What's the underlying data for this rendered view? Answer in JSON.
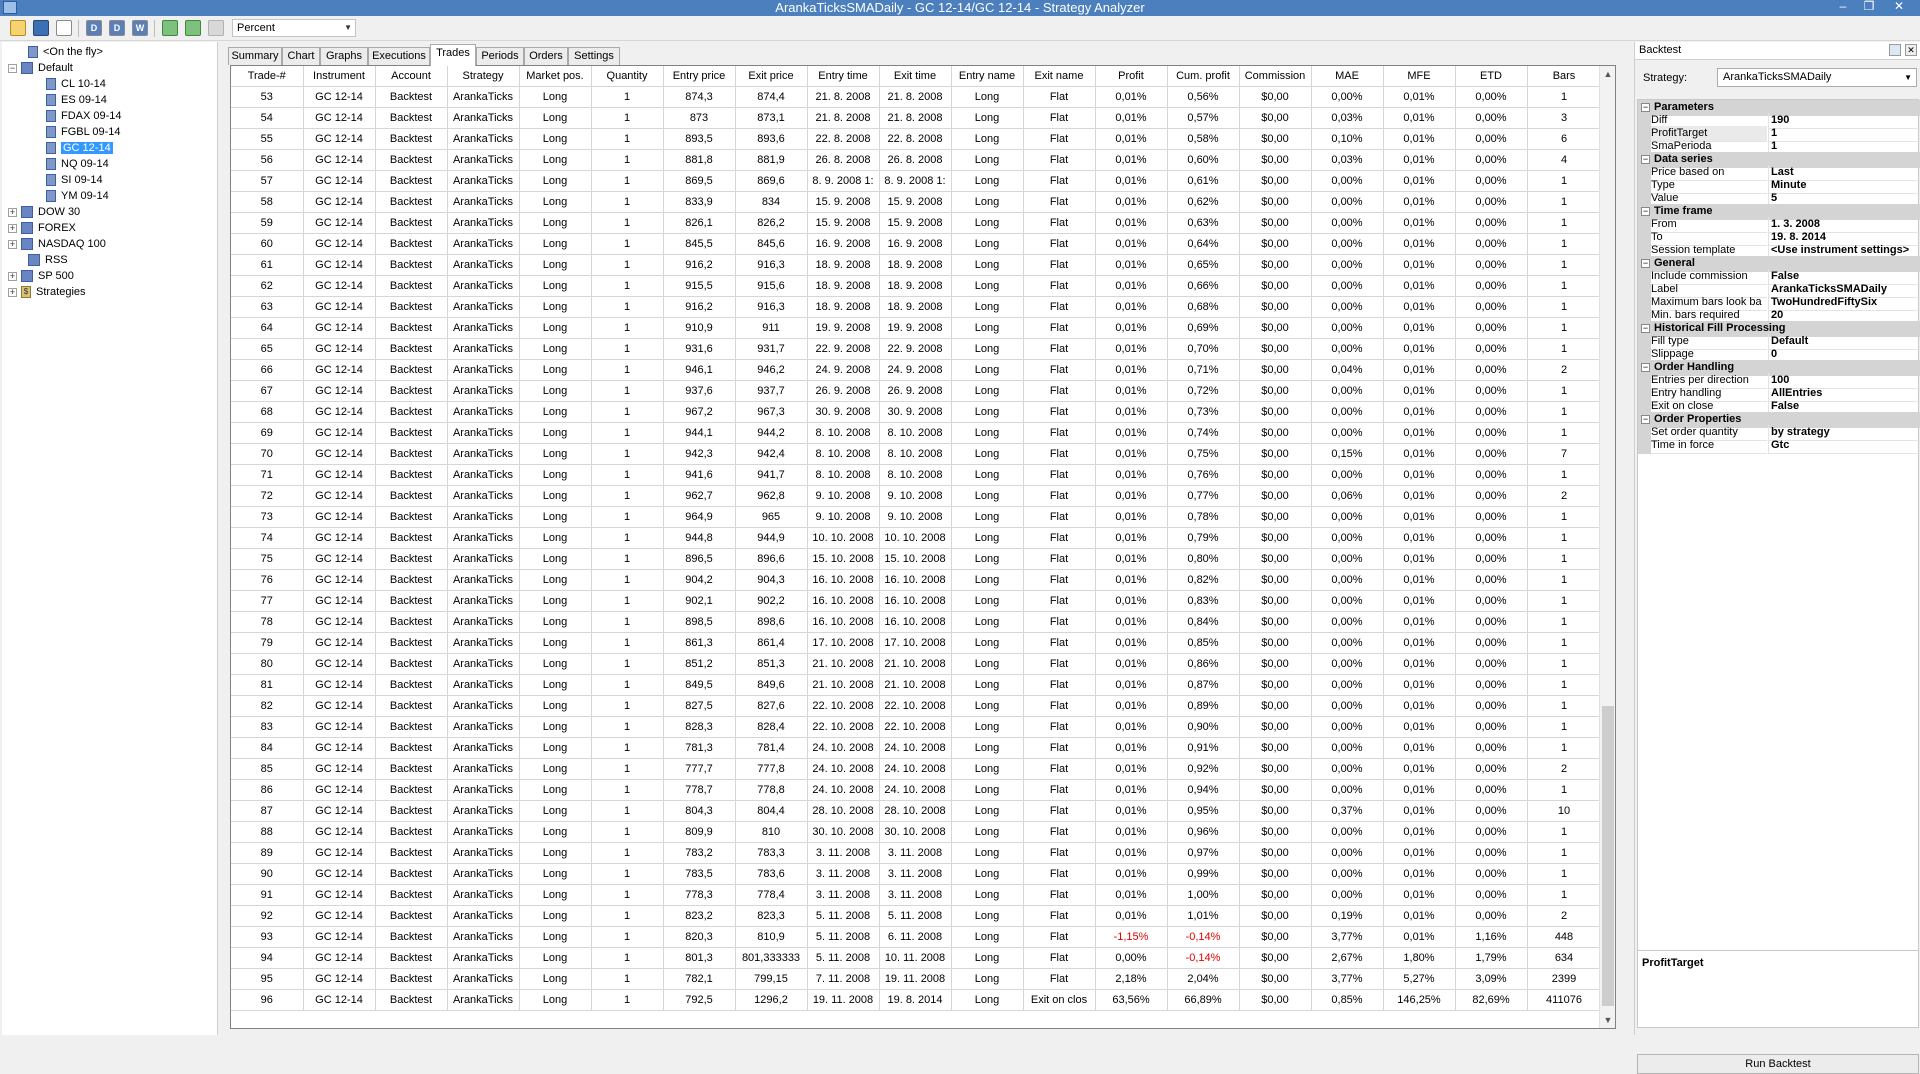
{
  "window": {
    "title": "ArankaTicksSMADaily - GC 12-14/GC 12-14 - Strategy Analyzer"
  },
  "toolbar": {
    "display_combo": "Percent"
  },
  "tree": {
    "nodes": [
      {
        "label": "<On the fly>"
      },
      {
        "label": "Default"
      },
      {
        "label": "CL 10-14"
      },
      {
        "label": "ES 09-14"
      },
      {
        "label": "FDAX 09-14"
      },
      {
        "label": "FGBL 09-14"
      },
      {
        "label": "GC 12-14"
      },
      {
        "label": "NQ 09-14"
      },
      {
        "label": "SI 09-14"
      },
      {
        "label": "YM 09-14"
      },
      {
        "label": "DOW 30"
      },
      {
        "label": "FOREX"
      },
      {
        "label": "NASDAQ 100"
      },
      {
        "label": "RSS"
      },
      {
        "label": "SP 500"
      },
      {
        "label": "Strategies"
      }
    ]
  },
  "tabs": [
    "Summary",
    "Chart",
    "Graphs",
    "Executions",
    "Trades",
    "Periods",
    "Orders",
    "Settings"
  ],
  "grid": {
    "columns": [
      "Trade-#",
      "Instrument",
      "Account",
      "Strategy",
      "Market pos.",
      "Quantity",
      "Entry price",
      "Exit price",
      "Entry time",
      "Exit time",
      "Entry name",
      "Exit name",
      "Profit",
      "Cum. profit",
      "Commission",
      "MAE",
      "MFE",
      "ETD",
      "Bars"
    ],
    "rows": [
      [
        "53",
        "GC 12-14",
        "Backtest",
        "ArankaTicks",
        "Long",
        "1",
        "874,3",
        "874,4",
        "21. 8. 2008",
        "21. 8. 2008",
        "Long",
        "Flat",
        "0,01%",
        "0,56%",
        "$0,00",
        "0,00%",
        "0,01%",
        "0,00%",
        "1"
      ],
      [
        "54",
        "GC 12-14",
        "Backtest",
        "ArankaTicks",
        "Long",
        "1",
        "873",
        "873,1",
        "21. 8. 2008",
        "21. 8. 2008",
        "Long",
        "Flat",
        "0,01%",
        "0,57%",
        "$0,00",
        "0,03%",
        "0,01%",
        "0,00%",
        "3"
      ],
      [
        "55",
        "GC 12-14",
        "Backtest",
        "ArankaTicks",
        "Long",
        "1",
        "893,5",
        "893,6",
        "22. 8. 2008",
        "22. 8. 2008",
        "Long",
        "Flat",
        "0,01%",
        "0,58%",
        "$0,00",
        "0,10%",
        "0,01%",
        "0,00%",
        "6"
      ],
      [
        "56",
        "GC 12-14",
        "Backtest",
        "ArankaTicks",
        "Long",
        "1",
        "881,8",
        "881,9",
        "26. 8. 2008",
        "26. 8. 2008",
        "Long",
        "Flat",
        "0,01%",
        "0,60%",
        "$0,00",
        "0,03%",
        "0,01%",
        "0,00%",
        "4"
      ],
      [
        "57",
        "GC 12-14",
        "Backtest",
        "ArankaTicks",
        "Long",
        "1",
        "869,5",
        "869,6",
        "8. 9. 2008 1:",
        "8. 9. 2008 1:",
        "Long",
        "Flat",
        "0,01%",
        "0,61%",
        "$0,00",
        "0,00%",
        "0,01%",
        "0,00%",
        "1"
      ],
      [
        "58",
        "GC 12-14",
        "Backtest",
        "ArankaTicks",
        "Long",
        "1",
        "833,9",
        "834",
        "15. 9. 2008",
        "15. 9. 2008",
        "Long",
        "Flat",
        "0,01%",
        "0,62%",
        "$0,00",
        "0,00%",
        "0,01%",
        "0,00%",
        "1"
      ],
      [
        "59",
        "GC 12-14",
        "Backtest",
        "ArankaTicks",
        "Long",
        "1",
        "826,1",
        "826,2",
        "15. 9. 2008",
        "15. 9. 2008",
        "Long",
        "Flat",
        "0,01%",
        "0,63%",
        "$0,00",
        "0,00%",
        "0,01%",
        "0,00%",
        "1"
      ],
      [
        "60",
        "GC 12-14",
        "Backtest",
        "ArankaTicks",
        "Long",
        "1",
        "845,5",
        "845,6",
        "16. 9. 2008",
        "16. 9. 2008",
        "Long",
        "Flat",
        "0,01%",
        "0,64%",
        "$0,00",
        "0,00%",
        "0,01%",
        "0,00%",
        "1"
      ],
      [
        "61",
        "GC 12-14",
        "Backtest",
        "ArankaTicks",
        "Long",
        "1",
        "916,2",
        "916,3",
        "18. 9. 2008",
        "18. 9. 2008",
        "Long",
        "Flat",
        "0,01%",
        "0,65%",
        "$0,00",
        "0,00%",
        "0,01%",
        "0,00%",
        "1"
      ],
      [
        "62",
        "GC 12-14",
        "Backtest",
        "ArankaTicks",
        "Long",
        "1",
        "915,5",
        "915,6",
        "18. 9. 2008",
        "18. 9. 2008",
        "Long",
        "Flat",
        "0,01%",
        "0,66%",
        "$0,00",
        "0,00%",
        "0,01%",
        "0,00%",
        "1"
      ],
      [
        "63",
        "GC 12-14",
        "Backtest",
        "ArankaTicks",
        "Long",
        "1",
        "916,2",
        "916,3",
        "18. 9. 2008",
        "18. 9. 2008",
        "Long",
        "Flat",
        "0,01%",
        "0,68%",
        "$0,00",
        "0,00%",
        "0,01%",
        "0,00%",
        "1"
      ],
      [
        "64",
        "GC 12-14",
        "Backtest",
        "ArankaTicks",
        "Long",
        "1",
        "910,9",
        "911",
        "19. 9. 2008",
        "19. 9. 2008",
        "Long",
        "Flat",
        "0,01%",
        "0,69%",
        "$0,00",
        "0,00%",
        "0,01%",
        "0,00%",
        "1"
      ],
      [
        "65",
        "GC 12-14",
        "Backtest",
        "ArankaTicks",
        "Long",
        "1",
        "931,6",
        "931,7",
        "22. 9. 2008",
        "22. 9. 2008",
        "Long",
        "Flat",
        "0,01%",
        "0,70%",
        "$0,00",
        "0,00%",
        "0,01%",
        "0,00%",
        "1"
      ],
      [
        "66",
        "GC 12-14",
        "Backtest",
        "ArankaTicks",
        "Long",
        "1",
        "946,1",
        "946,2",
        "24. 9. 2008",
        "24. 9. 2008",
        "Long",
        "Flat",
        "0,01%",
        "0,71%",
        "$0,00",
        "0,04%",
        "0,01%",
        "0,00%",
        "2"
      ],
      [
        "67",
        "GC 12-14",
        "Backtest",
        "ArankaTicks",
        "Long",
        "1",
        "937,6",
        "937,7",
        "26. 9. 2008",
        "26. 9. 2008",
        "Long",
        "Flat",
        "0,01%",
        "0,72%",
        "$0,00",
        "0,00%",
        "0,01%",
        "0,00%",
        "1"
      ],
      [
        "68",
        "GC 12-14",
        "Backtest",
        "ArankaTicks",
        "Long",
        "1",
        "967,2",
        "967,3",
        "30. 9. 2008",
        "30. 9. 2008",
        "Long",
        "Flat",
        "0,01%",
        "0,73%",
        "$0,00",
        "0,00%",
        "0,01%",
        "0,00%",
        "1"
      ],
      [
        "69",
        "GC 12-14",
        "Backtest",
        "ArankaTicks",
        "Long",
        "1",
        "944,1",
        "944,2",
        "8. 10. 2008",
        "8. 10. 2008",
        "Long",
        "Flat",
        "0,01%",
        "0,74%",
        "$0,00",
        "0,00%",
        "0,01%",
        "0,00%",
        "1"
      ],
      [
        "70",
        "GC 12-14",
        "Backtest",
        "ArankaTicks",
        "Long",
        "1",
        "942,3",
        "942,4",
        "8. 10. 2008",
        "8. 10. 2008",
        "Long",
        "Flat",
        "0,01%",
        "0,75%",
        "$0,00",
        "0,15%",
        "0,01%",
        "0,00%",
        "7"
      ],
      [
        "71",
        "GC 12-14",
        "Backtest",
        "ArankaTicks",
        "Long",
        "1",
        "941,6",
        "941,7",
        "8. 10. 2008",
        "8. 10. 2008",
        "Long",
        "Flat",
        "0,01%",
        "0,76%",
        "$0,00",
        "0,00%",
        "0,01%",
        "0,00%",
        "1"
      ],
      [
        "72",
        "GC 12-14",
        "Backtest",
        "ArankaTicks",
        "Long",
        "1",
        "962,7",
        "962,8",
        "9. 10. 2008",
        "9. 10. 2008",
        "Long",
        "Flat",
        "0,01%",
        "0,77%",
        "$0,00",
        "0,06%",
        "0,01%",
        "0,00%",
        "2"
      ],
      [
        "73",
        "GC 12-14",
        "Backtest",
        "ArankaTicks",
        "Long",
        "1",
        "964,9",
        "965",
        "9. 10. 2008",
        "9. 10. 2008",
        "Long",
        "Flat",
        "0,01%",
        "0,78%",
        "$0,00",
        "0,00%",
        "0,01%",
        "0,00%",
        "1"
      ],
      [
        "74",
        "GC 12-14",
        "Backtest",
        "ArankaTicks",
        "Long",
        "1",
        "944,8",
        "944,9",
        "10. 10. 2008",
        "10. 10. 2008",
        "Long",
        "Flat",
        "0,01%",
        "0,79%",
        "$0,00",
        "0,00%",
        "0,01%",
        "0,00%",
        "1"
      ],
      [
        "75",
        "GC 12-14",
        "Backtest",
        "ArankaTicks",
        "Long",
        "1",
        "896,5",
        "896,6",
        "15. 10. 2008",
        "15. 10. 2008",
        "Long",
        "Flat",
        "0,01%",
        "0,80%",
        "$0,00",
        "0,00%",
        "0,01%",
        "0,00%",
        "1"
      ],
      [
        "76",
        "GC 12-14",
        "Backtest",
        "ArankaTicks",
        "Long",
        "1",
        "904,2",
        "904,3",
        "16. 10. 2008",
        "16. 10. 2008",
        "Long",
        "Flat",
        "0,01%",
        "0,82%",
        "$0,00",
        "0,00%",
        "0,01%",
        "0,00%",
        "1"
      ],
      [
        "77",
        "GC 12-14",
        "Backtest",
        "ArankaTicks",
        "Long",
        "1",
        "902,1",
        "902,2",
        "16. 10. 2008",
        "16. 10. 2008",
        "Long",
        "Flat",
        "0,01%",
        "0,83%",
        "$0,00",
        "0,00%",
        "0,01%",
        "0,00%",
        "1"
      ],
      [
        "78",
        "GC 12-14",
        "Backtest",
        "ArankaTicks",
        "Long",
        "1",
        "898,5",
        "898,6",
        "16. 10. 2008",
        "16. 10. 2008",
        "Long",
        "Flat",
        "0,01%",
        "0,84%",
        "$0,00",
        "0,00%",
        "0,01%",
        "0,00%",
        "1"
      ],
      [
        "79",
        "GC 12-14",
        "Backtest",
        "ArankaTicks",
        "Long",
        "1",
        "861,3",
        "861,4",
        "17. 10. 2008",
        "17. 10. 2008",
        "Long",
        "Flat",
        "0,01%",
        "0,85%",
        "$0,00",
        "0,00%",
        "0,01%",
        "0,00%",
        "1"
      ],
      [
        "80",
        "GC 12-14",
        "Backtest",
        "ArankaTicks",
        "Long",
        "1",
        "851,2",
        "851,3",
        "21. 10. 2008",
        "21. 10. 2008",
        "Long",
        "Flat",
        "0,01%",
        "0,86%",
        "$0,00",
        "0,00%",
        "0,01%",
        "0,00%",
        "1"
      ],
      [
        "81",
        "GC 12-14",
        "Backtest",
        "ArankaTicks",
        "Long",
        "1",
        "849,5",
        "849,6",
        "21. 10. 2008",
        "21. 10. 2008",
        "Long",
        "Flat",
        "0,01%",
        "0,87%",
        "$0,00",
        "0,00%",
        "0,01%",
        "0,00%",
        "1"
      ],
      [
        "82",
        "GC 12-14",
        "Backtest",
        "ArankaTicks",
        "Long",
        "1",
        "827,5",
        "827,6",
        "22. 10. 2008",
        "22. 10. 2008",
        "Long",
        "Flat",
        "0,01%",
        "0,89%",
        "$0,00",
        "0,00%",
        "0,01%",
        "0,00%",
        "1"
      ],
      [
        "83",
        "GC 12-14",
        "Backtest",
        "ArankaTicks",
        "Long",
        "1",
        "828,3",
        "828,4",
        "22. 10. 2008",
        "22. 10. 2008",
        "Long",
        "Flat",
        "0,01%",
        "0,90%",
        "$0,00",
        "0,00%",
        "0,01%",
        "0,00%",
        "1"
      ],
      [
        "84",
        "GC 12-14",
        "Backtest",
        "ArankaTicks",
        "Long",
        "1",
        "781,3",
        "781,4",
        "24. 10. 2008",
        "24. 10. 2008",
        "Long",
        "Flat",
        "0,01%",
        "0,91%",
        "$0,00",
        "0,00%",
        "0,01%",
        "0,00%",
        "1"
      ],
      [
        "85",
        "GC 12-14",
        "Backtest",
        "ArankaTicks",
        "Long",
        "1",
        "777,7",
        "777,8",
        "24. 10. 2008",
        "24. 10. 2008",
        "Long",
        "Flat",
        "0,01%",
        "0,92%",
        "$0,00",
        "0,00%",
        "0,01%",
        "0,00%",
        "2"
      ],
      [
        "86",
        "GC 12-14",
        "Backtest",
        "ArankaTicks",
        "Long",
        "1",
        "778,7",
        "778,8",
        "24. 10. 2008",
        "24. 10. 2008",
        "Long",
        "Flat",
        "0,01%",
        "0,94%",
        "$0,00",
        "0,00%",
        "0,01%",
        "0,00%",
        "1"
      ],
      [
        "87",
        "GC 12-14",
        "Backtest",
        "ArankaTicks",
        "Long",
        "1",
        "804,3",
        "804,4",
        "28. 10. 2008",
        "28. 10. 2008",
        "Long",
        "Flat",
        "0,01%",
        "0,95%",
        "$0,00",
        "0,37%",
        "0,01%",
        "0,00%",
        "10"
      ],
      [
        "88",
        "GC 12-14",
        "Backtest",
        "ArankaTicks",
        "Long",
        "1",
        "809,9",
        "810",
        "30. 10. 2008",
        "30. 10. 2008",
        "Long",
        "Flat",
        "0,01%",
        "0,96%",
        "$0,00",
        "0,00%",
        "0,01%",
        "0,00%",
        "1"
      ],
      [
        "89",
        "GC 12-14",
        "Backtest",
        "ArankaTicks",
        "Long",
        "1",
        "783,2",
        "783,3",
        "3. 11. 2008",
        "3. 11. 2008",
        "Long",
        "Flat",
        "0,01%",
        "0,97%",
        "$0,00",
        "0,00%",
        "0,01%",
        "0,00%",
        "1"
      ],
      [
        "90",
        "GC 12-14",
        "Backtest",
        "ArankaTicks",
        "Long",
        "1",
        "783,5",
        "783,6",
        "3. 11. 2008",
        "3. 11. 2008",
        "Long",
        "Flat",
        "0,01%",
        "0,99%",
        "$0,00",
        "0,00%",
        "0,01%",
        "0,00%",
        "1"
      ],
      [
        "91",
        "GC 12-14",
        "Backtest",
        "ArankaTicks",
        "Long",
        "1",
        "778,3",
        "778,4",
        "3. 11. 2008",
        "3. 11. 2008",
        "Long",
        "Flat",
        "0,01%",
        "1,00%",
        "$0,00",
        "0,00%",
        "0,01%",
        "0,00%",
        "1"
      ],
      [
        "92",
        "GC 12-14",
        "Backtest",
        "ArankaTicks",
        "Long",
        "1",
        "823,2",
        "823,3",
        "5. 11. 2008",
        "5. 11. 2008",
        "Long",
        "Flat",
        "0,01%",
        "1,01%",
        "$0,00",
        "0,19%",
        "0,01%",
        "0,00%",
        "2"
      ],
      [
        "93",
        "GC 12-14",
        "Backtest",
        "ArankaTicks",
        "Long",
        "1",
        "820,3",
        "810,9",
        "5. 11. 2008",
        "6. 11. 2008",
        "Long",
        "Flat",
        "-1,15%",
        "-0,14%",
        "$0,00",
        "3,77%",
        "0,01%",
        "1,16%",
        "448"
      ],
      [
        "94",
        "GC 12-14",
        "Backtest",
        "ArankaTicks",
        "Long",
        "1",
        "801,3",
        "801,333333",
        "5. 11. 2008",
        "10. 11. 2008",
        "Long",
        "Flat",
        "0,00%",
        "-0,14%",
        "$0,00",
        "2,67%",
        "1,80%",
        "1,79%",
        "634"
      ],
      [
        "95",
        "GC 12-14",
        "Backtest",
        "ArankaTicks",
        "Long",
        "1",
        "782,1",
        "799,15",
        "7. 11. 2008",
        "19. 11. 2008",
        "Long",
        "Flat",
        "2,18%",
        "2,04%",
        "$0,00",
        "3,77%",
        "5,27%",
        "3,09%",
        "2399"
      ],
      [
        "96",
        "GC 12-14",
        "Backtest",
        "ArankaTicks",
        "Long",
        "1",
        "792,5",
        "1296,2",
        "19. 11. 2008",
        "19. 8. 2014",
        "Long",
        "Exit on clos",
        "63,56%",
        "66,89%",
        "$0,00",
        "0,85%",
        "146,25%",
        "82,69%",
        "411076"
      ]
    ]
  },
  "backtest": {
    "header": "Backtest",
    "strategy_label": "Strategy:",
    "strategy_value": "ArankaTicksSMADaily",
    "properties": [
      {
        "cat": "Parameters"
      },
      {
        "k": "Diff",
        "v": "190"
      },
      {
        "k": "ProfitTarget",
        "v": "1",
        "hl": true
      },
      {
        "k": "SmaPerioda",
        "v": "1"
      },
      {
        "cat": "Data series"
      },
      {
        "k": "Price based on",
        "v": "Last"
      },
      {
        "k": "Type",
        "v": "Minute"
      },
      {
        "k": "Value",
        "v": "5"
      },
      {
        "cat": "Time frame"
      },
      {
        "k": "From",
        "v": "1. 3. 2008"
      },
      {
        "k": "To",
        "v": "19. 8. 2014"
      },
      {
        "k": "Session template",
        "v": "<Use instrument settings>"
      },
      {
        "cat": "General"
      },
      {
        "k": "Include commission",
        "v": "False"
      },
      {
        "k": "Label",
        "v": "ArankaTicksSMADaily"
      },
      {
        "k": "Maximum bars look ba",
        "v": "TwoHundredFiftySix"
      },
      {
        "k": "Min. bars required",
        "v": "20"
      },
      {
        "cat": "Historical Fill Processing"
      },
      {
        "k": "Fill type",
        "v": "Default"
      },
      {
        "k": "Slippage",
        "v": "0"
      },
      {
        "cat": "Order Handling"
      },
      {
        "k": "Entries per direction",
        "v": "100"
      },
      {
        "k": "Entry handling",
        "v": "AllEntries"
      },
      {
        "k": "Exit on close",
        "v": "False"
      },
      {
        "cat": "Order Properties"
      },
      {
        "k": "Set order quantity",
        "v": "by strategy"
      },
      {
        "k": "Time in force",
        "v": "Gtc"
      }
    ],
    "description_title": "ProfitTarget",
    "run_button": "Run Backtest"
  },
  "colors": {
    "titlebar": "#4b7fbd",
    "negative": "#e60000",
    "selection": "#3399ff"
  }
}
